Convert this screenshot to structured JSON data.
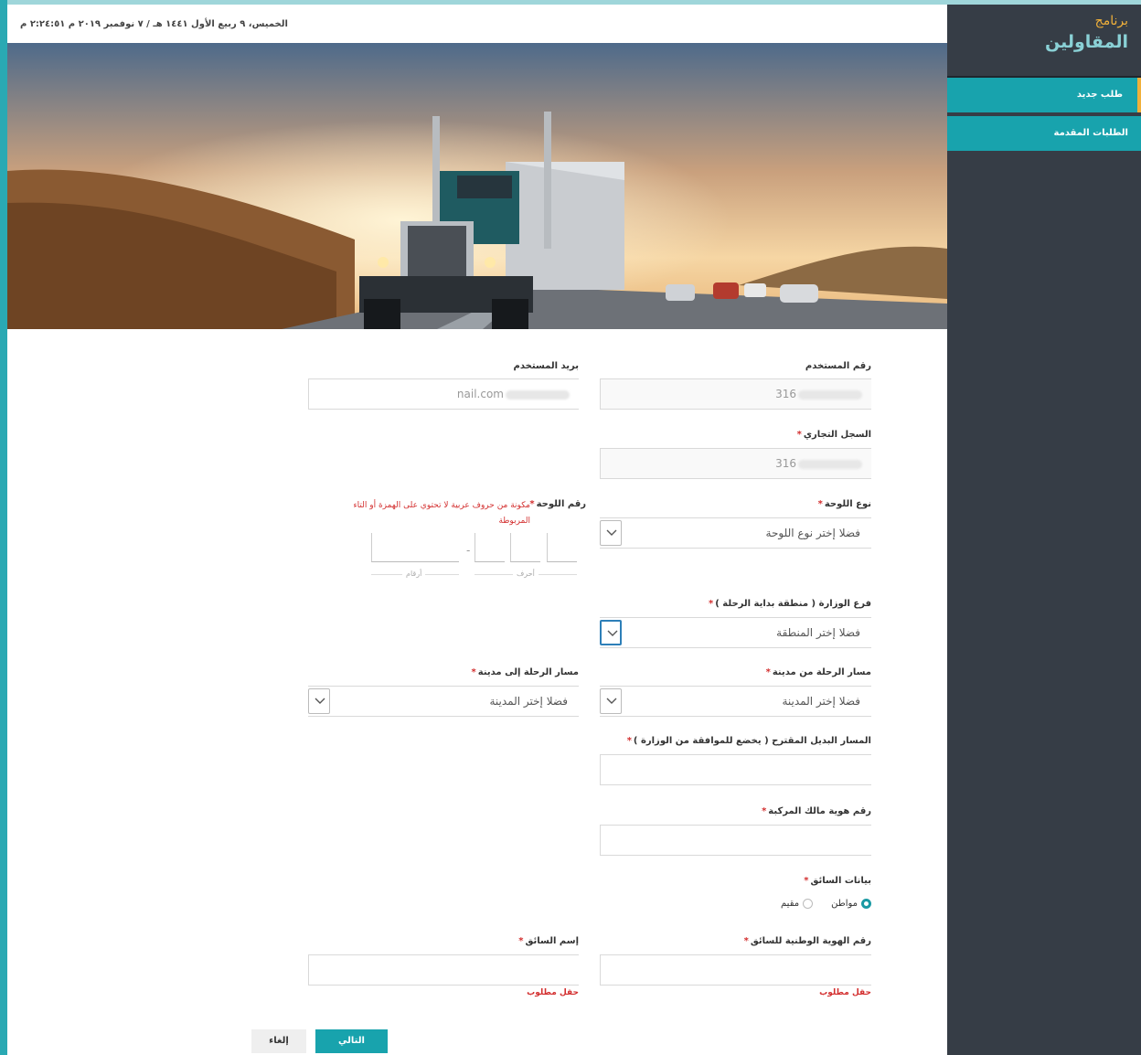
{
  "datebar": {
    "text": "الخميس، ٩ ربيع الأول ١٤٤١ هـ / ٧ نوفمبر ٢٠١٩ م ٢:٢٤:٥١ م"
  },
  "brand": {
    "line1": "برنامج",
    "line2": "المقاولين"
  },
  "sidebar": {
    "items": [
      {
        "label": "طلب جديد"
      },
      {
        "label": "الطلبات المقدمة"
      }
    ]
  },
  "form": {
    "user_number": {
      "label": "رقم المستخدم",
      "value_suffix": "316"
    },
    "user_email": {
      "label": "بريد المستخدم",
      "value_suffix": "nail.com"
    },
    "commercial_register": {
      "label": "السجل التجاري",
      "required_mark": "*",
      "value_suffix": "316"
    },
    "plate_type": {
      "label": "نوع اللوحة",
      "required_mark": "*",
      "selected": "فضلا إختر نوع اللوحة"
    },
    "plate_number": {
      "label": "رقم اللوحة",
      "required_mark": "*",
      "note": "مكونة من حروف عربية لا تحتوي على الهمزة أو التاء المربوطة",
      "letters_caption": "أحرف",
      "digits_caption": "أرقام",
      "separator": "-"
    },
    "ministry_branch": {
      "label": "فرع الوزارة ( منطقة بداية الرحلة )",
      "required_mark": "*",
      "selected": "فضلا إختر المنطقة"
    },
    "route_from": {
      "label": "مسار الرحلة من مدينة",
      "required_mark": "*",
      "selected": "فضلا إختر المدينة"
    },
    "route_to": {
      "label": "مسار الرحلة إلى مدينة",
      "required_mark": "*",
      "selected": "فضلا إختر المدينة"
    },
    "alt_route": {
      "label": "المسار البديل المقترح ( يخضع للموافقة من الوزارة )",
      "required_mark": "*"
    },
    "owner_id": {
      "label": "رقم هوية مالك المركبة",
      "required_mark": "*"
    },
    "driver_data": {
      "label": "بيانات السائق",
      "required_mark": "*",
      "options": [
        "مواطن",
        "مقيم"
      ],
      "selected": "مواطن"
    },
    "driver_national_id": {
      "label": "رقم الهوية الوطنية للسائق",
      "required_mark": "*",
      "error": "حقل مطلوب"
    },
    "driver_name": {
      "label": "إسم السائق",
      "required_mark": "*",
      "error": "حقل مطلوب"
    }
  },
  "buttons": {
    "next": "التالي",
    "cancel": "إلغاء"
  },
  "colors": {
    "accent": "#18a3ad",
    "sidebar": "#363d46",
    "brand_orange": "#f0b03a",
    "error": "#d32f2f"
  }
}
